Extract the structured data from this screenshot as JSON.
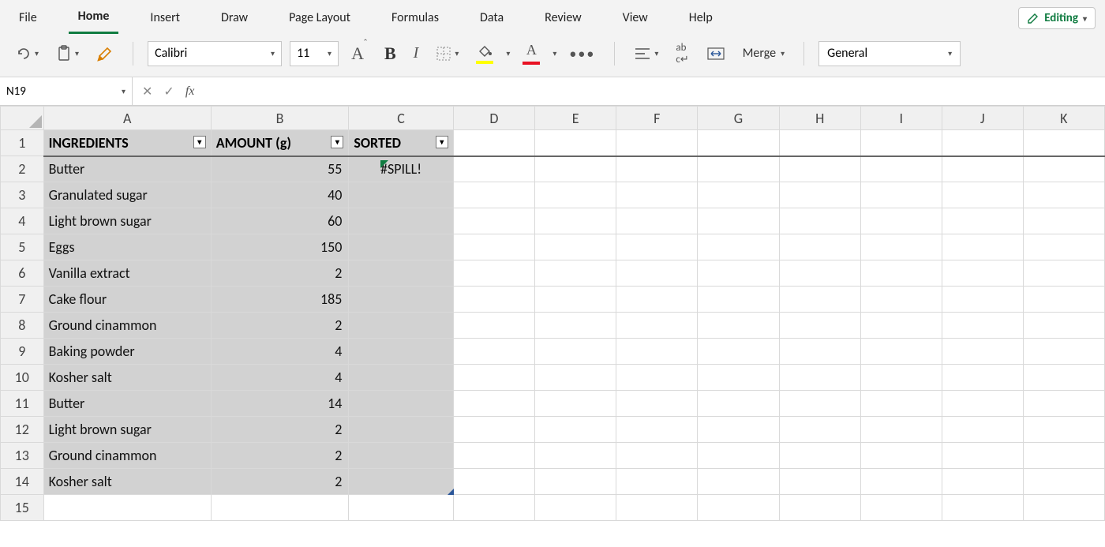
{
  "ribbon": {
    "tabs": [
      "File",
      "Home",
      "Insert",
      "Draw",
      "Page Layout",
      "Formulas",
      "Data",
      "Review",
      "View",
      "Help"
    ],
    "active": "Home",
    "editing_label": "Editing"
  },
  "toolbar": {
    "font_name": "Calibri",
    "font_size": "11",
    "merge_label": "Merge",
    "number_format": "General"
  },
  "formula_bar": {
    "name_box": "N19",
    "formula": ""
  },
  "columns": [
    "A",
    "B",
    "C",
    "D",
    "E",
    "F",
    "G",
    "H",
    "I",
    "J",
    "K"
  ],
  "headers": {
    "col_a": "INGREDIENTS",
    "col_b": "AMOUNT (g)",
    "col_c": "SORTED"
  },
  "spill_error": "#SPILL!",
  "rows": [
    {
      "ingredient": "Butter",
      "amount": "55"
    },
    {
      "ingredient": "Granulated sugar",
      "amount": "40"
    },
    {
      "ingredient": "Light brown sugar",
      "amount": "60"
    },
    {
      "ingredient": "Eggs",
      "amount": "150"
    },
    {
      "ingredient": "Vanilla extract",
      "amount": "2"
    },
    {
      "ingredient": "Cake flour",
      "amount": "185"
    },
    {
      "ingredient": "Ground cinammon",
      "amount": "2"
    },
    {
      "ingredient": "Baking powder",
      "amount": "4"
    },
    {
      "ingredient": "Kosher salt",
      "amount": "4"
    },
    {
      "ingredient": "Butter",
      "amount": "14"
    },
    {
      "ingredient": "Light brown sugar",
      "amount": "2"
    },
    {
      "ingredient": "Ground cinammon",
      "amount": "2"
    },
    {
      "ingredient": "Kosher salt",
      "amount": "2"
    }
  ],
  "row_numbers": [
    "1",
    "2",
    "3",
    "4",
    "5",
    "6",
    "7",
    "8",
    "9",
    "10",
    "11",
    "12",
    "13",
    "14",
    "15"
  ]
}
